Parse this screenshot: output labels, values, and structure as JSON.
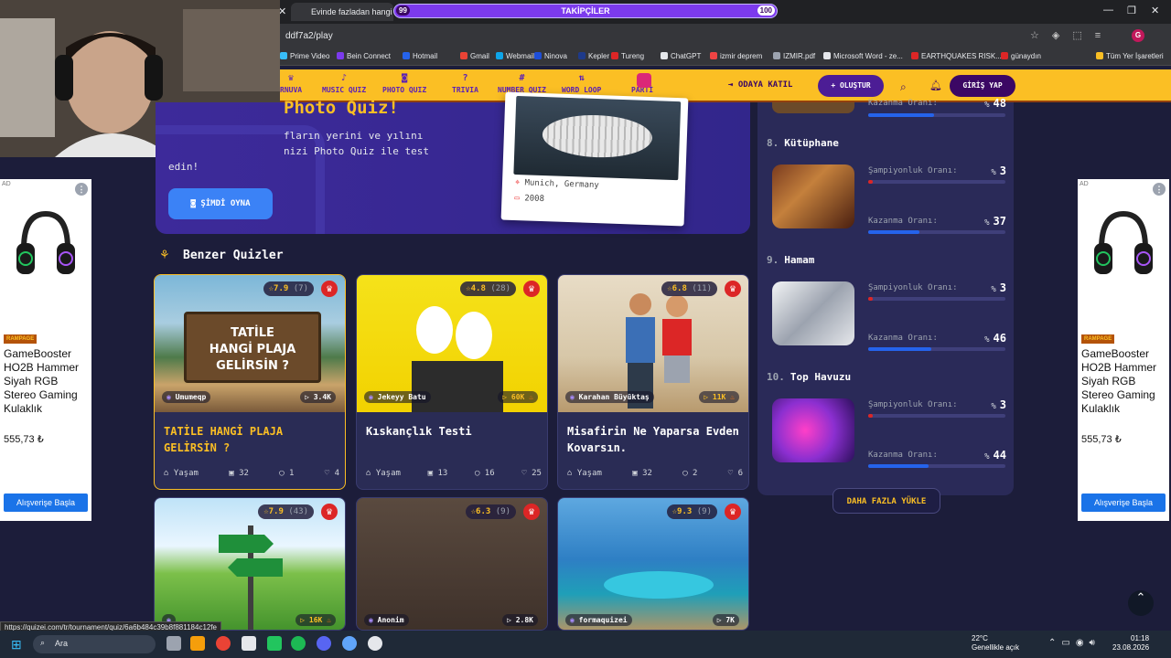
{
  "browser": {
    "tab_title": "Evinde fazladan hangi oda",
    "url": "ddf7a2/play",
    "follow_overlay": {
      "label": "TAKİPÇİLER",
      "current": "99",
      "goal": "100",
      "progress": 0.99
    },
    "bookmarks": [
      {
        "label": "Prime Video",
        "color": "#38bdf8"
      },
      {
        "label": "Bein Connect",
        "color": "#7c3aed"
      },
      {
        "label": "Hotmail",
        "color": "#2563eb"
      },
      {
        "label": "Gmail",
        "color": "#ea4335"
      },
      {
        "label": "Webmail",
        "color": "#0ea5e9"
      },
      {
        "label": "Ninova",
        "color": "#1d4ed8"
      },
      {
        "label": "Kepler",
        "color": "#1e3a8a"
      },
      {
        "label": "Tureng",
        "color": "#dc2626"
      },
      {
        "label": "ChatGPT",
        "color": "#e5e7eb"
      },
      {
        "label": "izmir deprem",
        "color": "#ef4444"
      },
      {
        "label": "IZMIR.pdf",
        "color": "#9ca3af"
      },
      {
        "label": "Microsoft Word - ze...",
        "color": "#e5e7eb"
      },
      {
        "label": "EARTHQUAKES RISK...",
        "color": "#dc2626"
      },
      {
        "label": "günaydın",
        "color": "#dc2626"
      }
    ],
    "all_bookmarks": "Tüm Yer İşaretleri",
    "profile_initial": "G",
    "status_url": "https://quizei.com/tr/tournament/quiz/6a6b484c39b8f881184c12fe"
  },
  "nav": {
    "items": [
      {
        "label": "RNUVA",
        "icon": "trophy-icon"
      },
      {
        "label": "MUSIC QUIZ",
        "icon": "music-icon"
      },
      {
        "label": "PHOTO QUIZ",
        "icon": "camera-icon"
      },
      {
        "label": "TRIVIA",
        "icon": "question-icon"
      },
      {
        "label": "NUMBER QUIZ",
        "icon": "hash-icon"
      },
      {
        "label": "WORD LOOP",
        "icon": "sort-icon"
      },
      {
        "label": "PARTİ",
        "icon": "party-icon"
      }
    ],
    "join_label": "ODAYA KATIL",
    "create_label": "+ OLUŞTUR",
    "login_label": "GİRİŞ YAP",
    "accent": "#fbbf24"
  },
  "hero": {
    "title": "Photo Quiz!",
    "desc_line1": "fların yerini ve yılını",
    "desc_line2": "nizi Photo Quiz ile test",
    "desc_line3": "edin!",
    "play_label": "ŞİMDİ OYNA",
    "photo_location": "Munich, Germany",
    "photo_year": "2008"
  },
  "similar": {
    "title": "Benzer Quizler",
    "cards": [
      {
        "rating": "7.9",
        "votes": "(7)",
        "author": "Umumeqp",
        "plays": "3.4K",
        "hot": false,
        "title": "TATİLE HANGİ PLAJA GELİRSİN ?",
        "category": "Yaşam",
        "items": "32",
        "comments": "1",
        "likes": "4"
      },
      {
        "rating": "4.8",
        "votes": "(28)",
        "author": "Jekeyy Batu",
        "plays": "60K",
        "hot": true,
        "title": "Kıskançlık Testi",
        "category": "Yaşam",
        "items": "13",
        "comments": "16",
        "likes": "25"
      },
      {
        "rating": "6.8",
        "votes": "(11)",
        "author": "Karahan Büyüktaş",
        "plays": "11K",
        "hot": true,
        "title": "Misafirin Ne Yaparsa Evden Kovarsın.",
        "category": "Yaşam",
        "items": "32",
        "comments": "2",
        "likes": "6"
      },
      {
        "rating": "7.9",
        "votes": "(43)",
        "author": "",
        "plays": "16K",
        "hot": true
      },
      {
        "rating": "6.3",
        "votes": "(9)",
        "author": "Anonim",
        "plays": "2.8K",
        "hot": false
      },
      {
        "rating": "9.3",
        "votes": "(9)",
        "author": "formaquizei",
        "plays": "7K",
        "hot": false
      }
    ]
  },
  "ranking": {
    "champ_label": "Şampiyonluk Oranı:",
    "win_label": "Kazanma Oranı:",
    "percent_sign": "%",
    "top": {
      "win_rate": "48",
      "win_fraction": 0.48
    },
    "items": [
      {
        "rank": "8.",
        "name": "Kütüphane",
        "champ": "3",
        "champ_fraction": 0.03,
        "win": "37",
        "win_fraction": 0.37
      },
      {
        "rank": "9.",
        "name": "Hamam",
        "champ": "3",
        "champ_fraction": 0.03,
        "win": "46",
        "win_fraction": 0.46
      },
      {
        "rank": "10.",
        "name": "Top Havuzu",
        "champ": "3",
        "champ_fraction": 0.03,
        "win": "44",
        "win_fraction": 0.44
      }
    ],
    "load_more": "DAHA FAZLA YÜKLE"
  },
  "ads": {
    "brand": "RAMPAGE",
    "product": "GameBooster HO2B Hammer Siyah RGB Stereo Gaming Kulaklık",
    "price": "555,73 ₺",
    "cta": "Alışverişe Başla",
    "badge": "AD"
  },
  "taskbar": {
    "search": "Ara",
    "temp": "22°C",
    "weather": "Genellikle açık",
    "time": "01:18",
    "date": "23.08.2026"
  }
}
